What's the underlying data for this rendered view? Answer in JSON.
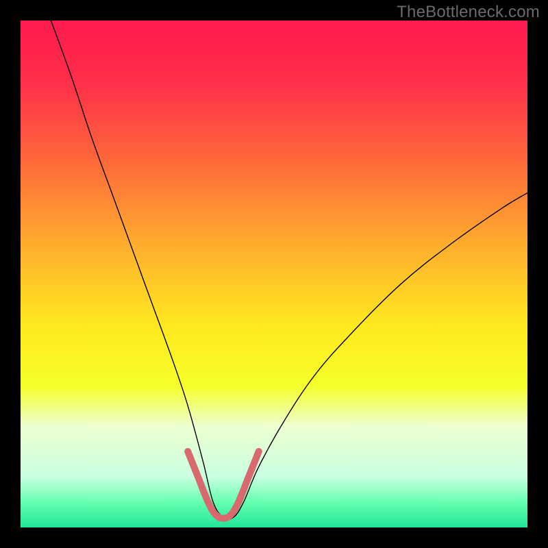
{
  "watermark": "TheBottleneck.com",
  "colors": {
    "frame": "#000000",
    "curve_thin": "#000000",
    "curve_thick": "#d86a6f",
    "watermark_text": "#6b6b6b",
    "gradient_stops": [
      {
        "offset": 0.0,
        "color": "#ff1a4f"
      },
      {
        "offset": 0.12,
        "color": "#ff2e4a"
      },
      {
        "offset": 0.28,
        "color": "#ff6a3a"
      },
      {
        "offset": 0.45,
        "color": "#ffb02c"
      },
      {
        "offset": 0.6,
        "color": "#ffe81f"
      },
      {
        "offset": 0.72,
        "color": "#f6ff29"
      },
      {
        "offset": 0.8,
        "color": "#edffd0"
      },
      {
        "offset": 0.9,
        "color": "#c9ffe0"
      },
      {
        "offset": 0.95,
        "color": "#66ffb0"
      },
      {
        "offset": 1.0,
        "color": "#22e698"
      }
    ]
  },
  "chart_data": {
    "type": "line",
    "title": "",
    "xlabel": "",
    "ylabel": "",
    "xlim": [
      0,
      100
    ],
    "ylim": [
      0,
      100
    ],
    "comment": "Bottleneck calculator V-curve. y≈0 is ideal (no bottleneck, green band). Dip near x≈40. Values estimated from pixel positions relative to plot area.",
    "series": [
      {
        "name": "curve-thin",
        "stroke": "curve_thin",
        "stroke_width": 1.4,
        "x": [
          6,
          10,
          14,
          18,
          22,
          26,
          30,
          33,
          36,
          38,
          40,
          42,
          44,
          47,
          52,
          58,
          65,
          75,
          85,
          95,
          100
        ],
        "y": [
          100,
          89,
          77,
          66,
          55,
          44,
          33,
          24,
          13,
          5,
          2,
          2,
          5,
          12,
          21,
          30,
          38,
          48,
          56,
          63,
          66
        ]
      },
      {
        "name": "curve-thick-highlight",
        "stroke": "curve_thick",
        "stroke_width": 10,
        "x": [
          33,
          35,
          37,
          38.5,
          40,
          41.5,
          43,
          45,
          47
        ],
        "y": [
          15,
          10,
          5,
          2.5,
          1.8,
          2.5,
          5,
          10,
          15
        ]
      }
    ],
    "bottom_band_y": 8,
    "dip_x": 40
  }
}
